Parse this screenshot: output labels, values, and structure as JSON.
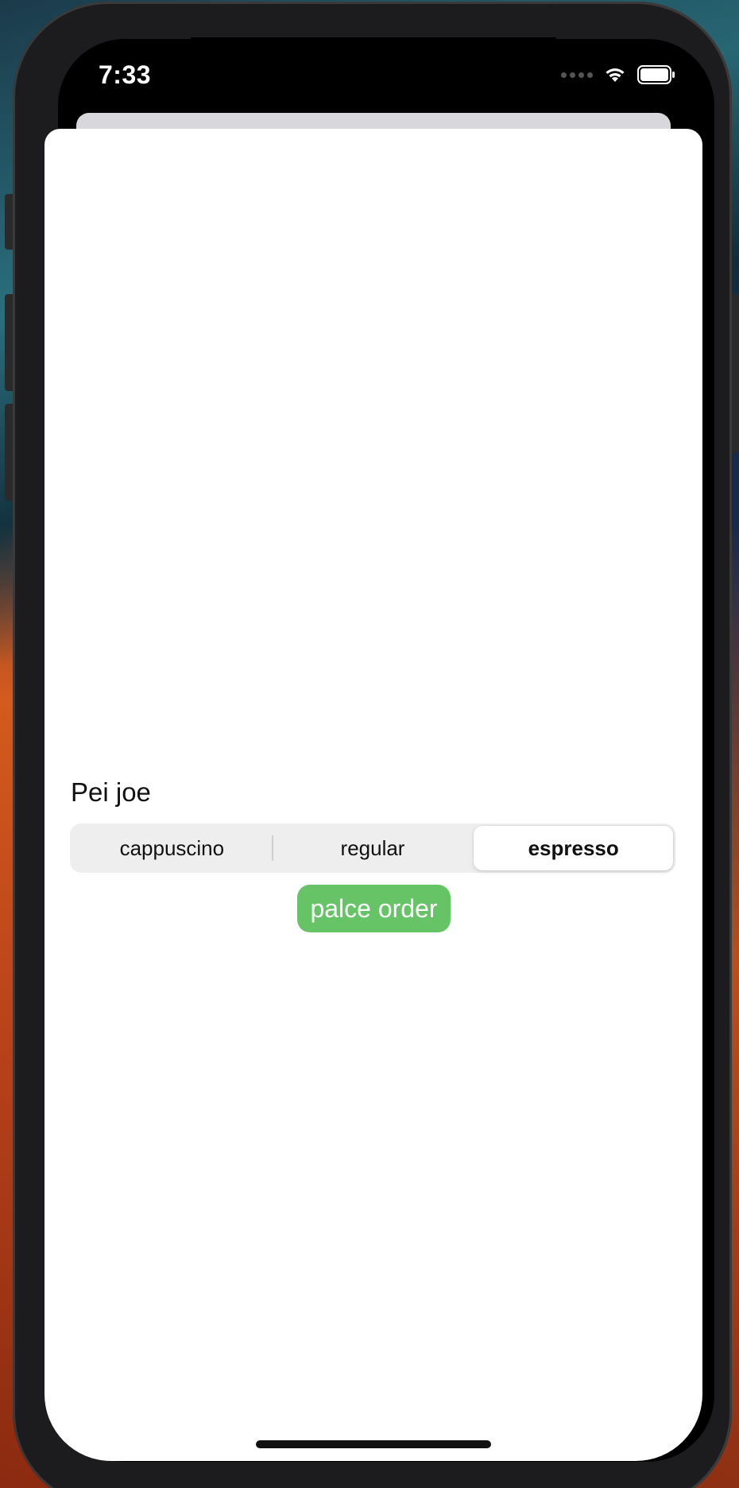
{
  "status_bar": {
    "time": "7:33",
    "icons": [
      "cellular-signal-icon",
      "wifi-icon",
      "battery-icon"
    ]
  },
  "content": {
    "name_label": "Pei joe",
    "coffee_types": {
      "options": [
        "cappuscino",
        "regular",
        "espresso"
      ],
      "selected": "espresso"
    },
    "order_button_label": "palce order"
  },
  "colors": {
    "order_button": "#66c466",
    "segment_background": "#eeeeef",
    "segment_selected": "#ffffff"
  }
}
